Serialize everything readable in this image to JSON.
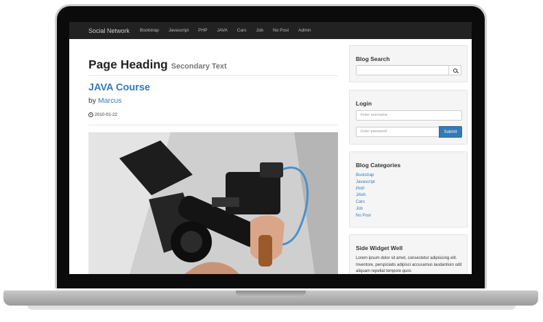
{
  "navbar": {
    "brand": "Social Network",
    "links": [
      "Bootstrap",
      "Javascript",
      "PHP",
      "JAVA",
      "Cars",
      "Job",
      "No Post",
      "Admin"
    ]
  },
  "main": {
    "page_heading": "Page Heading",
    "page_heading_secondary": "Secondary Text",
    "post": {
      "title": "JAVA Course",
      "by_label": "by",
      "author": "Marcus",
      "date": "2010-01-22",
      "date_icon": "clock-icon"
    }
  },
  "sidebar": {
    "search": {
      "title": "Blog Search",
      "placeholder": "",
      "button_icon": "search-icon"
    },
    "login": {
      "title": "Login",
      "username_placeholder": "Enter username",
      "password_placeholder": "Enter password",
      "submit_label": "Submit"
    },
    "categories": {
      "title": "Blog Categories",
      "items": [
        "Bootstrap",
        "Javascript",
        "PHP",
        "JAVA",
        "Cars",
        "Job",
        "No Post"
      ]
    },
    "side_widget": {
      "title": "Side Widget Well",
      "text": "Lorem ipsum dolor sit amet, consectetur adipisicing elit. Inventore, perspiciatis adipisci accusamus laudantium odit aliquam repellat tempore quos"
    }
  },
  "colors": {
    "navbar_bg": "#222222",
    "link": "#337ab7",
    "primary_button": "#337ab7",
    "well_bg": "#f5f5f5"
  }
}
